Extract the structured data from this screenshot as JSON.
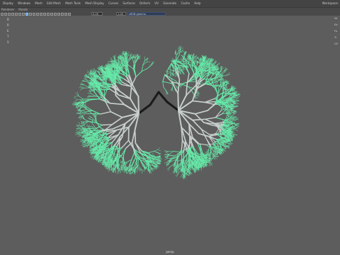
{
  "menubar": {
    "items": [
      "Display",
      "Windows",
      "Mesh",
      "Edit Mesh",
      "Mesh Tools",
      "Mesh Display",
      "Curves",
      "Surfaces",
      "Deform",
      "UV",
      "Generate",
      "Cache",
      "Help"
    ],
    "workspace": "Workspace:"
  },
  "panel_menu": {
    "items": [
      "Renderer",
      "Panels"
    ]
  },
  "toolbar": {
    "exposure": "0.00",
    "gamma": "1.00",
    "colorspace": "sRGB gamma"
  },
  "side_strip": {
    "items": [
      "B",
      "R",
      "E",
      "T",
      "S"
    ]
  },
  "right_hud": {
    "rows": [
      "Ve",
      "Ed",
      "Fa",
      "Tr",
      "UV"
    ]
  },
  "viewport": {
    "camera": "persp",
    "colors": {
      "background": "#5d5d5d",
      "branch_outer": "#66e8a8",
      "branch_inner": "#c7cfcc",
      "trachea": "#1a1a1a"
    }
  }
}
